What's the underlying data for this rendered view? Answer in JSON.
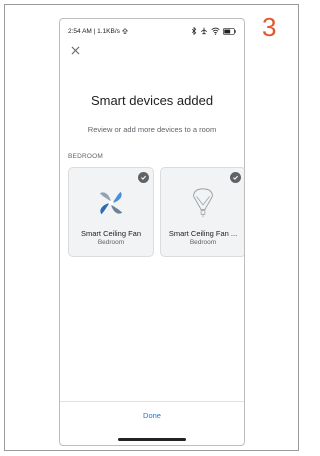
{
  "step_number": "3",
  "status_bar": {
    "left_text": "2:54 AM | 1.1KB/s",
    "icons": [
      "upload-icon",
      "bluetooth-icon",
      "airplane-icon",
      "wifi-icon",
      "battery-icon"
    ]
  },
  "header": {
    "title": "Smart devices added",
    "subtitle": "Review or add more devices to a room"
  },
  "section": {
    "label": "BEDROOM"
  },
  "devices": [
    {
      "name": "Smart Ceiling Fan",
      "room": "Bedroom",
      "icon": "fan-icon",
      "selected": true
    },
    {
      "name": "Smart Ceiling Fan ...",
      "room": "Bedroom",
      "icon": "bulb-icon",
      "selected": true
    }
  ],
  "footer": {
    "done_label": "Done"
  },
  "colors": {
    "accent": "#1a73e8",
    "step": "#e4572e",
    "card": "#f1f3f4"
  }
}
